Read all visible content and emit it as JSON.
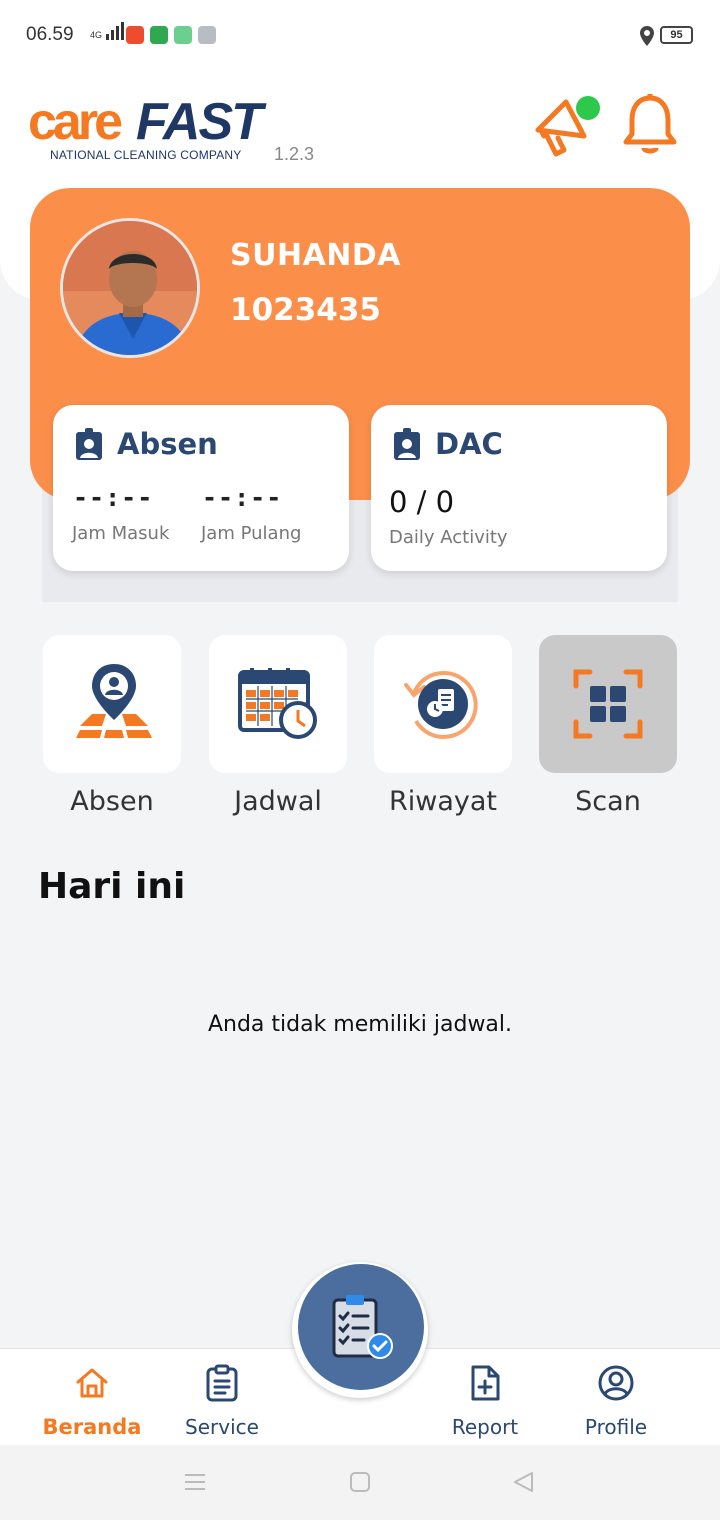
{
  "status_bar": {
    "time": "06.59",
    "network": "4G",
    "battery": "95",
    "app_icons": [
      "shopee-icon",
      "tokopedia-icon",
      "app-green-icon",
      "app-gray-icon"
    ]
  },
  "header": {
    "logo_primary": "care",
    "logo_secondary": "FAST",
    "logo_tagline": "NATIONAL CLEANING COMPANY",
    "version": "1.2.3",
    "notification_dot_color": "#2ec84d"
  },
  "profile": {
    "name": "SUHANDA",
    "employee_id": "1023435",
    "card_color": "#fb8e49"
  },
  "absen_card": {
    "title": "Absen",
    "check_in_value": "--:--",
    "check_in_label": "Jam Masuk",
    "check_out_value": "--:--",
    "check_out_label": "Jam Pulang"
  },
  "dac_card": {
    "title": "DAC",
    "value": "0 / 0",
    "label": "Daily Activity"
  },
  "menu": [
    {
      "label": "Absen",
      "icon": "location-person-icon"
    },
    {
      "label": "Jadwal",
      "icon": "calendar-clock-icon"
    },
    {
      "label": "Riwayat",
      "icon": "history-icon"
    },
    {
      "label": "Scan",
      "icon": "qr-scan-icon"
    }
  ],
  "today": {
    "title": "Hari ini",
    "empty_message": "Anda tidak memiliki jadwal."
  },
  "bottom_nav": {
    "items": [
      {
        "label": "Beranda",
        "icon": "home-icon",
        "active": true
      },
      {
        "label": "Service",
        "icon": "clipboard-icon",
        "active": false
      },
      {
        "label": "Report",
        "icon": "file-add-icon",
        "active": false
      },
      {
        "label": "Profile",
        "icon": "user-circle-icon",
        "active": false
      }
    ],
    "fab_icon": "checklist-icon"
  },
  "colors": {
    "accent": "#f47920",
    "navy": "#2b4872",
    "background": "#f3f4f6"
  }
}
